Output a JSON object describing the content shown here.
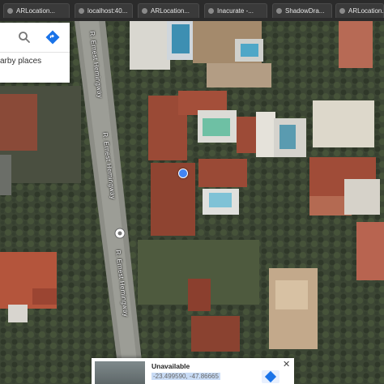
{
  "browser": {
    "tabs": [
      {
        "label": "ARLocation..."
      },
      {
        "label": "localhost:40..."
      },
      {
        "label": "ARLocation..."
      },
      {
        "label": "Inacurate -..."
      },
      {
        "label": "ShadowDra..."
      },
      {
        "label": "ARLocation..."
      }
    ]
  },
  "search_panel": {
    "nearby_label": "arby places",
    "search_icon": "search-icon",
    "directions_icon": "directions-icon"
  },
  "map": {
    "type": "satellite",
    "street_name": "R. Ernest Hemingway",
    "accent_color": "#4285f4"
  },
  "street_view_card": {
    "title": "Unavailable",
    "coordinates": "-23.499590, -47.86665",
    "close_icon": "close-icon"
  }
}
